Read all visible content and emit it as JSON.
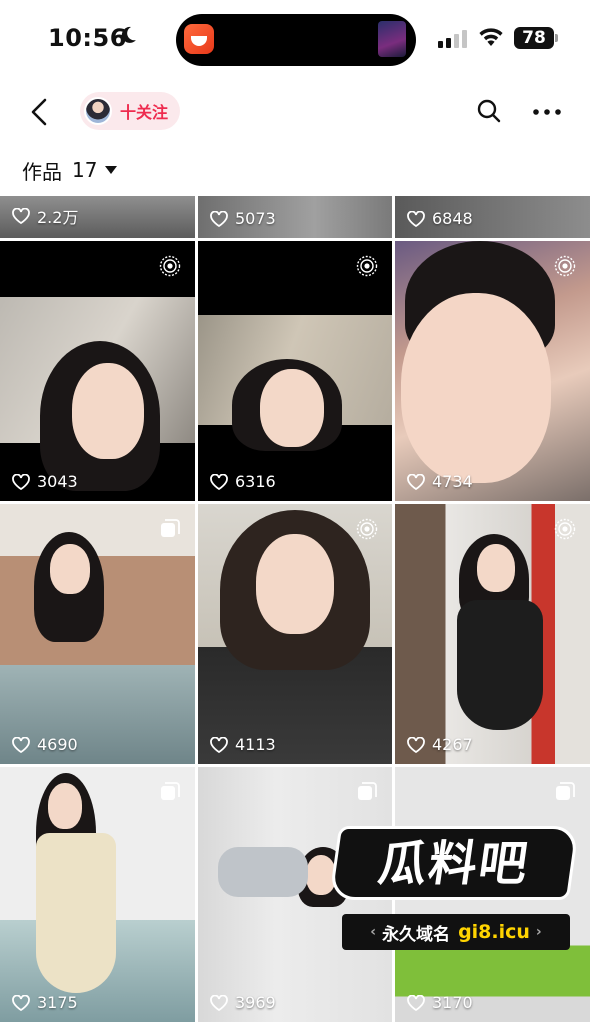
{
  "status_bar": {
    "time": "10:56",
    "battery": "78",
    "moon_icon": "moon-icon",
    "signal_icon": "cellular-signal-icon",
    "wifi_icon": "wifi-icon"
  },
  "nav": {
    "back_icon": "chevron-left-icon",
    "follow_label": "十关注",
    "search_icon": "search-icon",
    "more_icon": "more-dots-icon"
  },
  "works": {
    "label": "作品",
    "count": "17"
  },
  "grid": {
    "tiles": [
      {
        "likes": "2.2万",
        "type": "none"
      },
      {
        "likes": "5073",
        "type": "none"
      },
      {
        "likes": "6848",
        "type": "none"
      },
      {
        "likes": "3043",
        "type": "live-photo"
      },
      {
        "likes": "6316",
        "type": "live-photo"
      },
      {
        "likes": "4734",
        "type": "live-photo"
      },
      {
        "likes": "4690",
        "type": "gallery"
      },
      {
        "likes": "4113",
        "type": "live-photo"
      },
      {
        "likes": "4267",
        "type": "live-photo"
      },
      {
        "likes": "3175",
        "type": "gallery"
      },
      {
        "likes": "3969",
        "type": "gallery"
      },
      {
        "likes": "3170",
        "type": "gallery"
      }
    ]
  },
  "watermark": {
    "title": "瓜料吧",
    "subtitle": "永久域名",
    "domain": "gi8.icu"
  },
  "colors": {
    "follow_text": "#ee2c4f",
    "follow_bg": "#fbe9ec"
  }
}
